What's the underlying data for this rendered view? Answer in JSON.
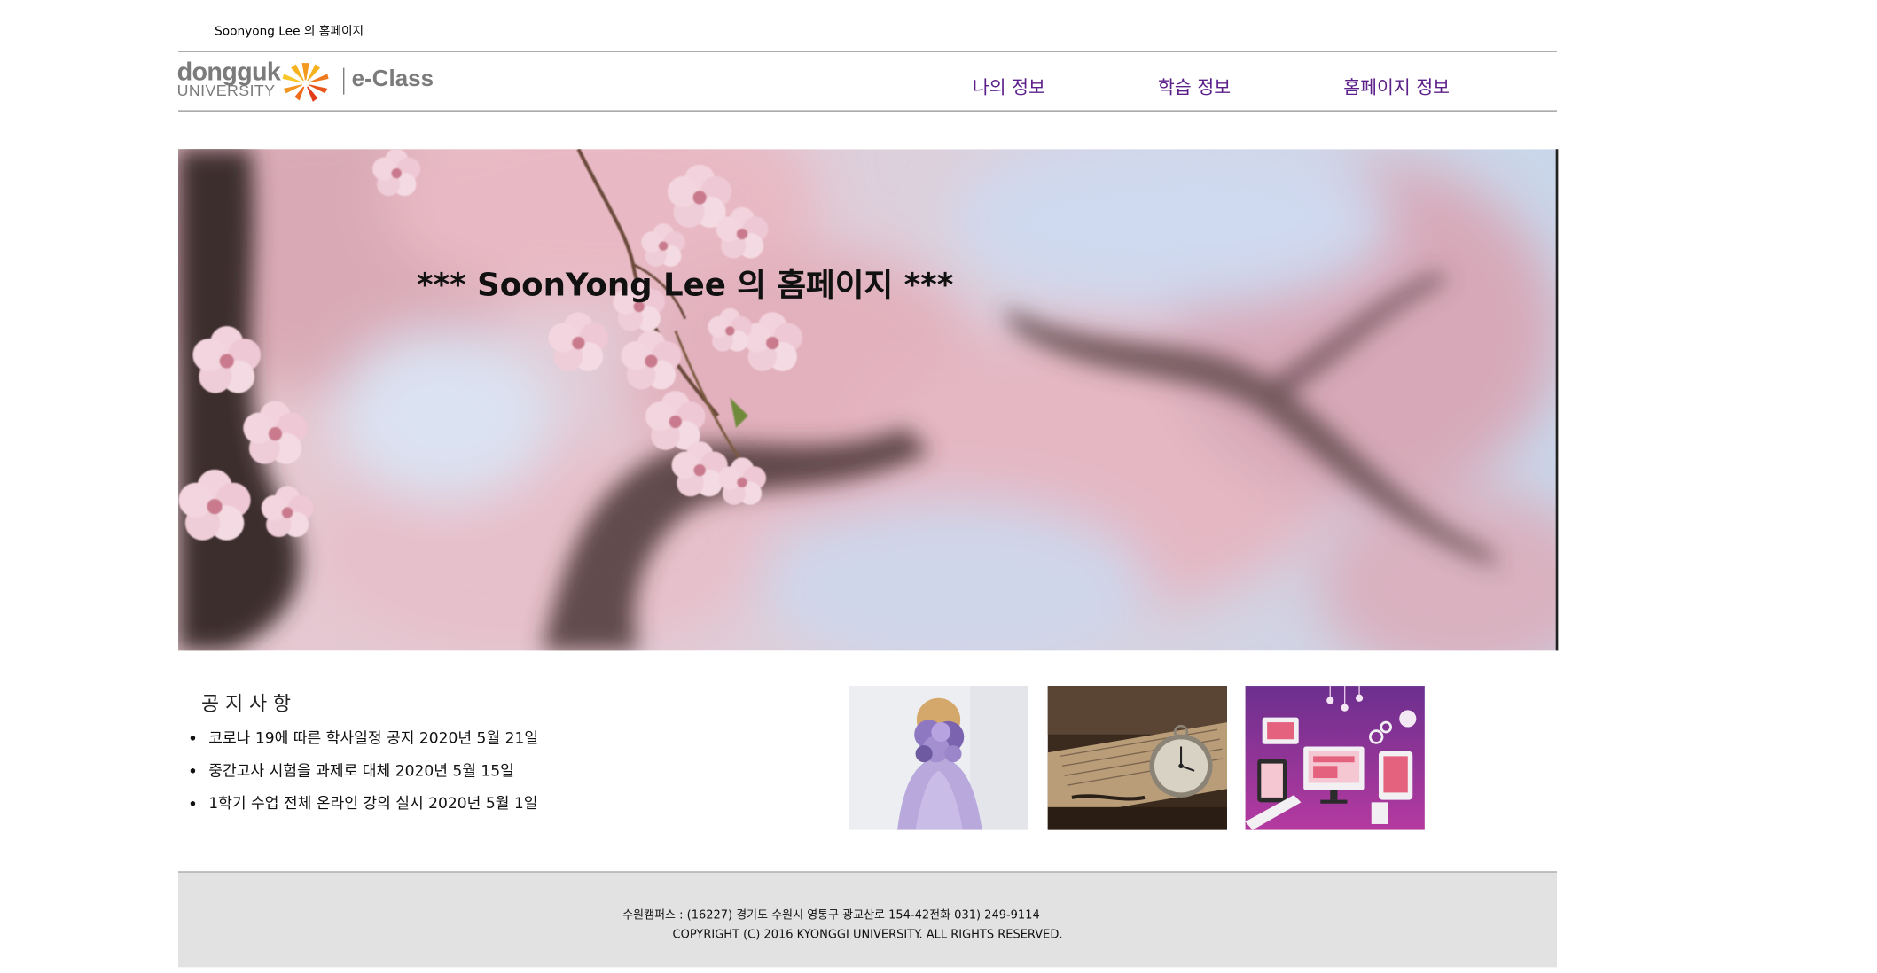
{
  "site": {
    "title": "Soonyong Lee 의 홈페이지"
  },
  "logo": {
    "line1": "dongguk",
    "line2": "UNIVERSITY",
    "product": "e-Class"
  },
  "nav": {
    "items": [
      {
        "label": "나의 정보"
      },
      {
        "label": "학습 정보"
      },
      {
        "label": "홈페이지 정보"
      }
    ],
    "color": "#5b1f8a"
  },
  "hero": {
    "title": "*** SoonYong Lee 의 홈페이지 ***"
  },
  "notice": {
    "title": "공지사항",
    "items": [
      "코로나 19에 따른 학사일정 공지 2020년 5월 21일",
      "중간고사 시험을 과제로 대체 2020년 5월 15일",
      "1학기 수업 전체 온라인 강의 실시 2020년 5월 1일"
    ]
  },
  "footer": {
    "address": "수원캠퍼스 : (16227) 경기도 수원시 영통구 광교산로 154-42전화 031) 249-9114",
    "copyright": "COPYRIGHT (C) 2016 KYONGGI UNIVERSITY. ALL RIGHTS RESERVED.",
    "background": "#e2e2e2"
  }
}
